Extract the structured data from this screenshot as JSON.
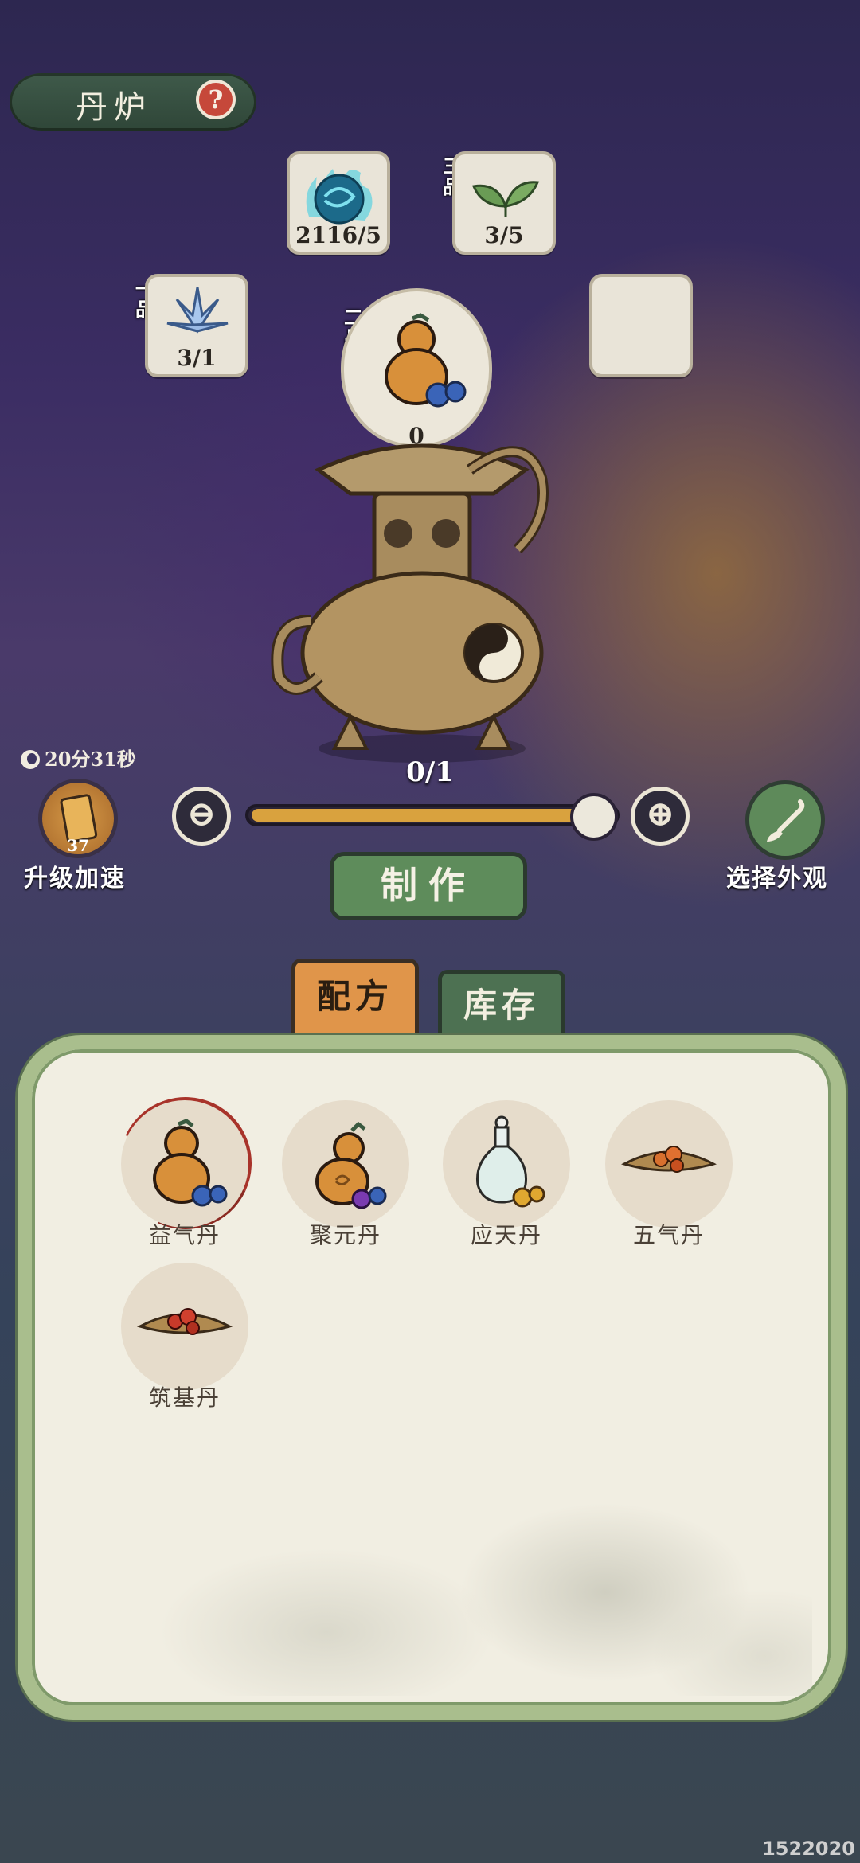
{
  "header": {
    "title": "丹炉",
    "help_symbol": "?"
  },
  "ingredients": {
    "top_left": {
      "count": "2116/5",
      "icon": "blue-spirit-orb-icon"
    },
    "top_right": {
      "grade": "三品",
      "count": "3/5",
      "icon": "green-leaf-icon"
    },
    "mid_left": {
      "grade": "一品",
      "count": "3/1",
      "icon": "blue-lily-icon"
    },
    "center": {
      "grade": "二品",
      "count": "0",
      "icon": "gourd-pill-icon"
    },
    "mid_right": {
      "count": "",
      "icon": "empty-slot"
    }
  },
  "controls": {
    "timer": "20分31秒",
    "upgrade_count": "37",
    "upgrade_label": "升级加速",
    "quantity": "0/1",
    "slider_fraction": 1.0,
    "minus_symbol": "⊖",
    "plus_symbol": "⊕",
    "appearance_label": "选择外观",
    "craft_label": "制作"
  },
  "tabs": {
    "recipe": "配方",
    "inventory": "库存"
  },
  "recipes": [
    {
      "name": "益气丹",
      "icon": "gourd-pill-icon",
      "selected": true
    },
    {
      "name": "聚元丹",
      "icon": "gourd-purple-pill-icon",
      "selected": false
    },
    {
      "name": "应天丹",
      "icon": "bottle-pill-icon",
      "selected": false
    },
    {
      "name": "五气丹",
      "icon": "leaf-tray-pill-icon",
      "selected": false
    },
    {
      "name": "筑基丹",
      "icon": "leaf-tray-red-pill-icon",
      "selected": false
    }
  ],
  "watermark": "1522020",
  "colors": {
    "accent_orange": "#e0954a",
    "accent_green": "#5e8c5b",
    "selected_ring": "#a8332a"
  }
}
